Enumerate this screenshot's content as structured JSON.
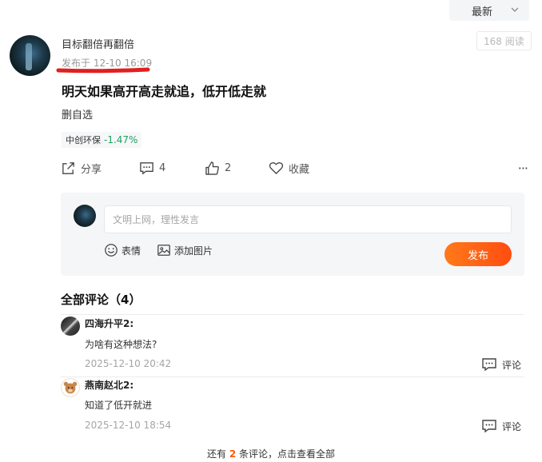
{
  "sort": {
    "selected": "最新"
  },
  "post": {
    "author": "目标翻倍再翻倍",
    "time": "发布于 12-10 16:09",
    "views": "168 阅读",
    "title": "明天如果高开高走就追，低开低走就",
    "body": "删自选",
    "stock": {
      "name": "中创环保",
      "change": "-1.47%"
    },
    "actions": {
      "share": "分享",
      "comment_count": "4",
      "like_count": "2",
      "favorite": "收藏",
      "more": "···"
    }
  },
  "compose": {
    "placeholder": "文明上网，理性发言",
    "emoji_label": "表情",
    "image_label": "添加图片",
    "publish_label": "发布"
  },
  "comments": {
    "header": "全部评论（4）",
    "items": [
      {
        "user": "四海升平2:",
        "text": "为啥有这种想法?",
        "time": "2025-12-10 20:42",
        "reply": "评论"
      },
      {
        "user": "燕南赵北2:",
        "text": "知道了低开就进",
        "time": "2025-12-10 18:54",
        "reply": "评论"
      }
    ],
    "more": {
      "prefix": "还有",
      "count": "2",
      "suffix": "条评论，点击查看全部"
    }
  },
  "colors": {
    "accent": "#ff5b00",
    "up_down_green": "#20a162",
    "annotation_red": "#e0201f"
  }
}
